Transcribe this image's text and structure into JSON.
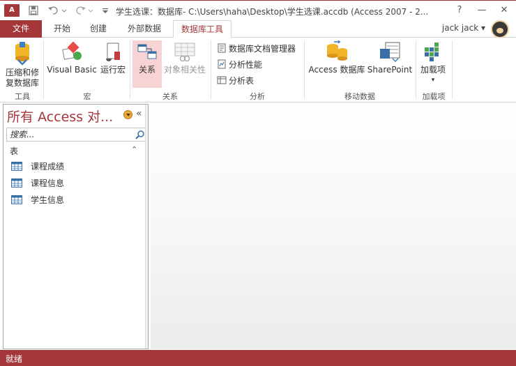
{
  "window": {
    "title": "学生选课：数据库- C:\\Users\\haha\\Desktop\\学生选课.accdb (Access 2007 - 2...",
    "app_icon_text": "A",
    "help_glyph": "?",
    "minimize_glyph": "—",
    "close_glyph": "✕"
  },
  "tabs": {
    "file": "文件",
    "home": "开始",
    "create": "创建",
    "external": "外部数据",
    "database_tools": "数据库工具"
  },
  "user": {
    "name": "jack jack ▾"
  },
  "ribbon": {
    "tools": {
      "compact_l1": "压缩和修",
      "compact_l2": "复数据库",
      "label": "工具"
    },
    "macro": {
      "visual_basic": "Visual Basic",
      "run_macro": "运行宏",
      "label": "宏"
    },
    "relationships": {
      "relations": "关系",
      "dependencies": "对象相关性",
      "label": "关系"
    },
    "analyze": {
      "documenter": "数据库文档管理器",
      "performance": "分析性能",
      "table": "分析表",
      "label": "分析"
    },
    "move": {
      "access_db": "Access 数据库",
      "sharepoint": "SharePoint",
      "label": "移动数据"
    },
    "addins": {
      "addins": "加载项",
      "dropdown": "▾",
      "label": "加载项"
    }
  },
  "nav": {
    "header": "所有 Access 对...",
    "collapse": "«",
    "search_placeholder": "搜索...",
    "section": "表",
    "section_toggle": "⌃",
    "items": [
      "课程成绩",
      "课程信息",
      "学生信息"
    ]
  },
  "status": {
    "text": "就绪"
  },
  "colors": {
    "accent": "#a4373a"
  }
}
